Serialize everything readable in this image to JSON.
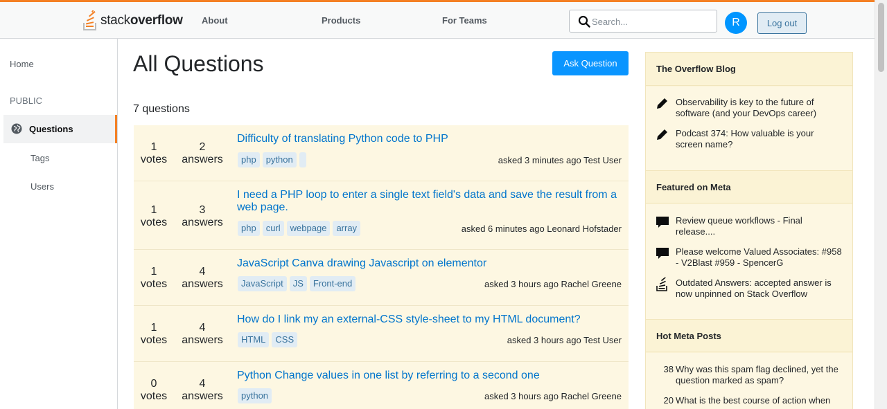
{
  "header": {
    "logo_light": "stack",
    "logo_bold": "overflow",
    "nav": [
      "About",
      "Products",
      "For Teams"
    ],
    "search_placeholder": "Search...",
    "avatar_initial": "R",
    "logout_label": "Log out"
  },
  "sidebar": {
    "home": "Home",
    "public": "PUBLIC",
    "questions": "Questions",
    "tags": "Tags",
    "users": "Users"
  },
  "main": {
    "title": "All Questions",
    "ask_label": "Ask Question",
    "count": "7 questions",
    "questions": [
      {
        "votes": "1",
        "votes_label": "votes",
        "answers": "2",
        "answers_label": "answers",
        "title": "Difficulty of translating Python code to PHP",
        "tags": [
          "php",
          "python",
          ""
        ],
        "asked": "asked 3 minutes ago Test User"
      },
      {
        "votes": "1",
        "votes_label": "votes",
        "answers": "3",
        "answers_label": "answers",
        "title": "I need a PHP loop to enter a single text field's data and save the result from a web page.",
        "tags": [
          "php",
          "curl",
          "webpage",
          "array"
        ],
        "asked": "asked 6 minutes ago Leonard Hofstader"
      },
      {
        "votes": "1",
        "votes_label": "votes",
        "answers": "4",
        "answers_label": "answers",
        "title": "JavaScript Canva drawing Javascript on elementor",
        "tags": [
          "JavaScript",
          "JS",
          "Front-end"
        ],
        "asked": "asked 3 hours ago Rachel Greene"
      },
      {
        "votes": "1",
        "votes_label": "votes",
        "answers": "4",
        "answers_label": "answers",
        "title": "How do I link my an external-CSS style-sheet to my HTML document?",
        "tags": [
          "HTML",
          "CSS"
        ],
        "asked": "asked 3 hours ago Test User"
      },
      {
        "votes": "0",
        "votes_label": "votes",
        "answers": "4",
        "answers_label": "answers",
        "title": "Python Change values in one list by referring to a second one",
        "tags": [
          "python"
        ],
        "asked": "asked 3 hours ago Rachel Greene"
      }
    ]
  },
  "right": {
    "blog_title": "The Overflow Blog",
    "blog_items": [
      {
        "icon": "pencil-icon",
        "text": "Observability is key to the future of software (and your DevOps career)"
      },
      {
        "icon": "pencil-icon",
        "text": "Podcast 374: How valuable is your screen name?"
      }
    ],
    "meta_title": "Featured on Meta",
    "meta_items": [
      {
        "icon": "chat-bubble-icon",
        "text": "Review queue workflows - Final release...."
      },
      {
        "icon": "chat-bubble-icon",
        "text": "Please welcome Valued Associates: #958 - V2Blast #959 - SpencerG"
      },
      {
        "icon": "stackoverflow-icon",
        "text": "Outdated Answers: accepted answer is now unpinned on Stack Overflow"
      }
    ],
    "hot_title": "Hot Meta Posts",
    "hot_items": [
      {
        "count": "38",
        "text": "Why was this spam flag declined, yet the question marked as spam?"
      },
      {
        "count": "20",
        "text": "What is the best course of action when"
      }
    ]
  },
  "colors": {
    "accent": "#f48024",
    "link": "#0074cc",
    "button": "#0a95ff",
    "row_bg": "#fdf7e2"
  }
}
